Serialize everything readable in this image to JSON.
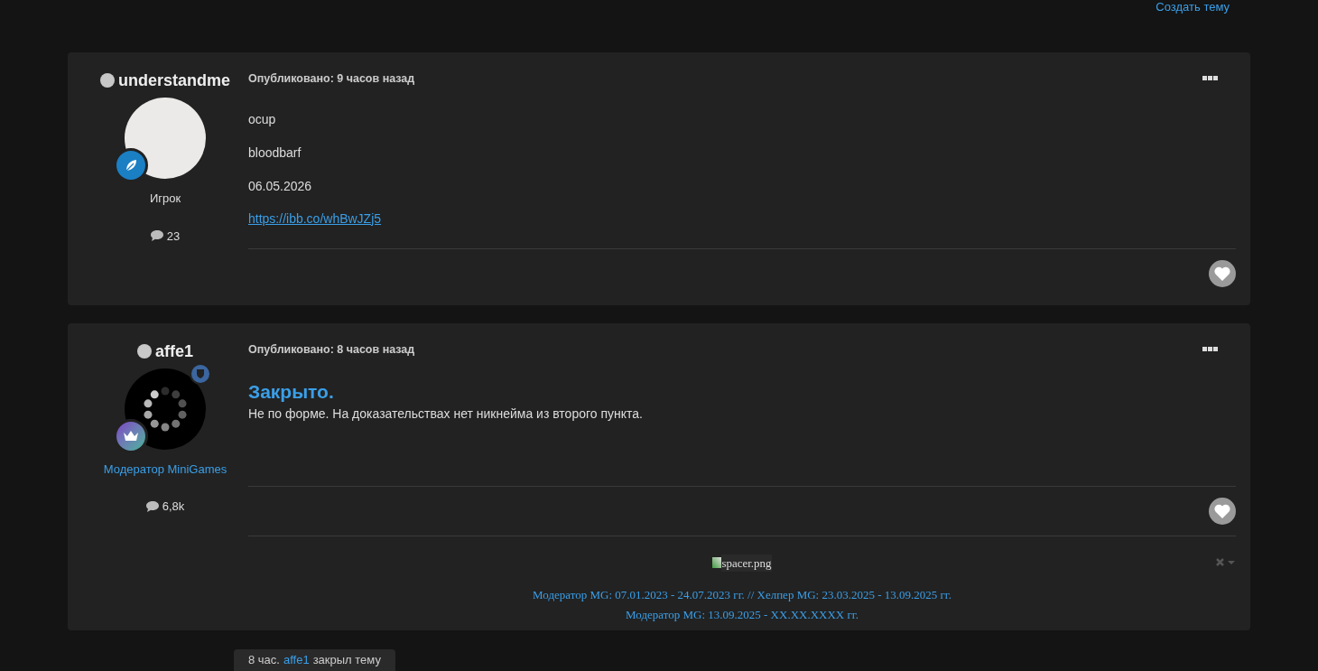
{
  "top_link": "Создать тему",
  "posts": [
    {
      "author": "understandme",
      "online": false,
      "avatar": {
        "kind": "photo"
      },
      "badge": {
        "kind": "leaf"
      },
      "role": "Игрок",
      "role_link": false,
      "posts_count": "23",
      "moderator": false,
      "published": "Опубликовано: 9 часов назад",
      "body": [
        {
          "kind": "text",
          "text": "ocup"
        },
        {
          "kind": "text",
          "text": "bloodbarf"
        },
        {
          "kind": "text",
          "text": "06.05.2026"
        },
        {
          "kind": "link",
          "text": "https://ibb.co/whBwJZj5"
        }
      ]
    },
    {
      "author": "affe1",
      "online": false,
      "avatar": {
        "kind": "loader"
      },
      "badge": {
        "kind": "crown"
      },
      "role": "Модератор MiniGames",
      "role_link": true,
      "posts_count": "6,8k",
      "moderator": true,
      "published": "Опубликовано: 8 часов назад",
      "heading": "Закрыто.",
      "body": [
        {
          "kind": "text",
          "text": "Не по форме.  На доказательствах нет никнейма из второго пункта."
        }
      ],
      "signature": {
        "image_alt": "spacer.png",
        "lines": [
          "Модератор MG: 07.01.2023 - 24.07.2023 гг. // Хелпер MG: 23.03.2025 - 13.09.2025 гг.",
          "Модератор MG: 13.09.2025 - XX.XX.XXXX гг."
        ]
      }
    }
  ],
  "event": {
    "time": "8 час.",
    "user": "affe1",
    "action": "закрыл тему"
  }
}
